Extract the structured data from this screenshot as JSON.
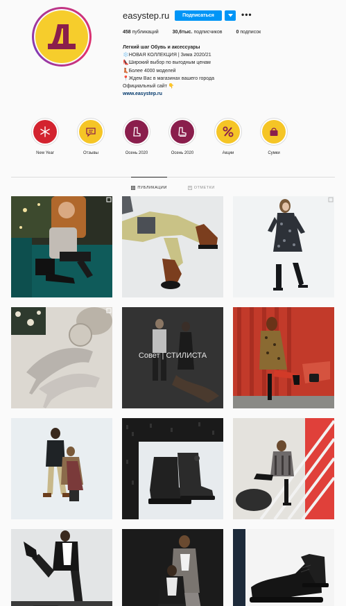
{
  "profile": {
    "username": "easystep.ru",
    "follow_label": "Подписаться",
    "more_label": "•••",
    "stats": {
      "posts_count": "458",
      "posts_label": "публикаций",
      "followers_count": "30,6тыс.",
      "followers_label": "подписчиков",
      "following_count": "0",
      "following_label": "подписок"
    },
    "bio": {
      "name": "Легкий шаг Обувь и аксессуары",
      "line1": "❄️НОВАЯ КОЛЛЕКЦИЯ | Зима 2020/21",
      "line2": "👠Широкий выбор по выгодным ценам",
      "line3": "👢Более 4000 моделей",
      "line4": "📍Ждем Вас в магазинах вашего города",
      "line5": "Официальный сайт 👇",
      "link": "www.easystep.ru"
    }
  },
  "highlights": [
    {
      "label": "New Year",
      "icon": "snowflake-icon",
      "color": "#d3232f"
    },
    {
      "label": "Отзывы",
      "icon": "chat-icon",
      "color": "#f5c526"
    },
    {
      "label": "Осень 2020",
      "icon": "boot-icon",
      "color": "#8a1e4c"
    },
    {
      "label": "Осень 2020",
      "icon": "boot-icon",
      "color": "#8a1e4c"
    },
    {
      "label": "Акции",
      "icon": "percent-icon",
      "color": "#f5c526"
    },
    {
      "label": "Сумки",
      "icon": "bag-icon",
      "color": "#f5c526"
    }
  ],
  "tabs": {
    "posts": "ПУБЛИКАЦИИ",
    "tagged": "ОТМЕТКИ"
  },
  "posts": [
    {
      "alt": "couple-on-green-sofa",
      "overlay": ""
    },
    {
      "alt": "man-brown-boots",
      "overlay": ""
    },
    {
      "alt": "woman-black-dress",
      "overlay": ""
    },
    {
      "alt": "silver-heels",
      "overlay": ""
    },
    {
      "alt": "stylist-advice",
      "overlay": "Совет | СТИЛИСТА"
    },
    {
      "alt": "woman-red-background",
      "overlay": ""
    },
    {
      "alt": "couple-white-background",
      "overlay": ""
    },
    {
      "alt": "black-ugg-boots",
      "overlay": ""
    },
    {
      "alt": "woman-jumping",
      "overlay": ""
    },
    {
      "alt": "man-kicking",
      "overlay": ""
    },
    {
      "alt": "couple-sitting",
      "overlay": ""
    },
    {
      "alt": "black-shoes",
      "overlay": ""
    }
  ],
  "colors": {
    "brand_yellow": "#f6cd2c",
    "brand_burgundy": "#8a1e4c",
    "follow_blue": "#0095f6"
  }
}
